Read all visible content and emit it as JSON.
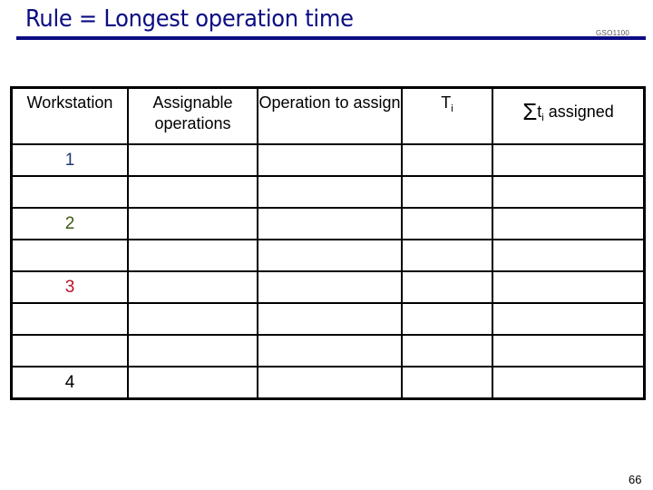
{
  "slide": {
    "title": "Rule = Longest operation time",
    "code": "GSO1100",
    "page_number": "66",
    "colors": {
      "title": "#0b0b84",
      "ws1": "#1f3b73",
      "ws2": "#3e5a12",
      "ws3": "#c0102a",
      "ws4": "#000000"
    }
  },
  "table": {
    "headers": {
      "workstation": "Workstation",
      "assignable": "Assignable operations",
      "operation": "Operation to assign",
      "ti_main": "T",
      "ti_sub": "i",
      "sum_sigma": "Σ",
      "sum_t": "t",
      "sum_sub": "i",
      "sum_label": " assigned"
    },
    "rows": [
      {
        "workstation": "1",
        "assignable": "",
        "operation": "",
        "ti": "",
        "sum": ""
      },
      {
        "workstation": "",
        "assignable": "",
        "operation": "",
        "ti": "",
        "sum": ""
      },
      {
        "workstation": "2",
        "assignable": "",
        "operation": "",
        "ti": "",
        "sum": ""
      },
      {
        "workstation": "",
        "assignable": "",
        "operation": "",
        "ti": "",
        "sum": ""
      },
      {
        "workstation": "3",
        "assignable": "",
        "operation": "",
        "ti": "",
        "sum": ""
      },
      {
        "workstation": "",
        "assignable": "",
        "operation": "",
        "ti": "",
        "sum": ""
      },
      {
        "workstation": "",
        "assignable": "",
        "operation": "",
        "ti": "",
        "sum": ""
      },
      {
        "workstation": "4",
        "assignable": "",
        "operation": "",
        "ti": "",
        "sum": ""
      }
    ]
  }
}
